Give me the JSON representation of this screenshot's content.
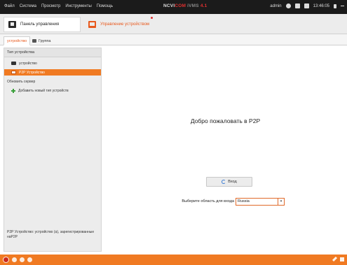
{
  "menubar": {
    "menus": [
      "Файл",
      "Система",
      "Просмотр",
      "Инструменты",
      "Помощь"
    ],
    "app_title_main": "NCVI",
    "app_title_mid": "COM",
    "app_title_tail": " iVMS",
    "app_title_ver": "4.1",
    "user": "admin",
    "time": "13:46:05"
  },
  "toolbar": {
    "panel_label": "Панель управления",
    "manage_label": "Управление устройством"
  },
  "subtabs": {
    "device_label": "устройство",
    "group_label": "Группа"
  },
  "sidebar": {
    "header": "Тип устройства",
    "items": [
      {
        "label": "устройство",
        "icon": "device-icon"
      },
      {
        "label": "P2P Устройство",
        "icon": "p2p-device-icon",
        "active": true
      },
      {
        "label": "Обновить сервер",
        "icon": ""
      },
      {
        "label": "Добавить новый тип устройств",
        "icon": "plus-icon"
      }
    ],
    "status": "P2P Устройство: устройство (а), зарегистрированные наP2P"
  },
  "main": {
    "welcome": "Добро пожаловать в P2P",
    "login_label": "Вход",
    "region_label": "Выберите область для входа",
    "region_value": "Russia"
  },
  "colors": {
    "accent": "#f07a22",
    "menubar": "#1b1b1b",
    "warn": "#c81e1e"
  }
}
